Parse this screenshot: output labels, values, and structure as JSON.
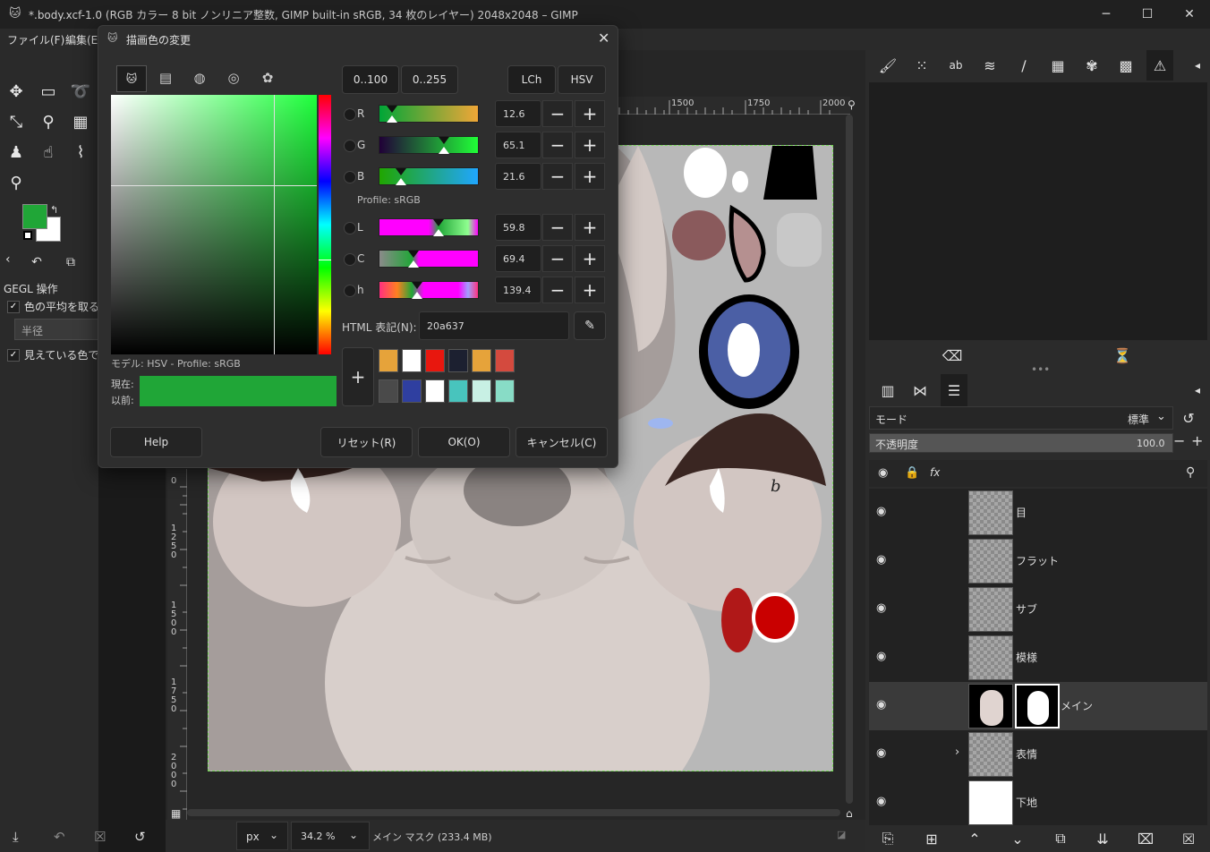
{
  "window": {
    "title": "*.body.xcf-1.0 (RGB カラー 8 bit ノンリニア整数, GIMP built-in sRGB, 34 枚のレイヤー) 2048x2048 – GIMP"
  },
  "menu": [
    "ファイル(F)",
    "編集(E)"
  ],
  "toolbox": {
    "gegl_label": "GEGL 操作",
    "avg_label": "色の平均を取る",
    "radius_label": "半径",
    "visible_label": "見えている色で"
  },
  "ruler": {
    "t1500": "1500",
    "t1750": "1750",
    "t2000": "2000"
  },
  "left_ruler": [
    "0",
    "1250",
    "1500",
    "1750",
    "2000"
  ],
  "statusbar": {
    "unit": "px",
    "zoom": "34.2 %",
    "info": "メイン マスク (233.4 MB)"
  },
  "dialog": {
    "title": "描画色の変更",
    "range_buttons": [
      "0..100",
      "0..255"
    ],
    "mode_buttons": [
      "LCh",
      "HSV"
    ],
    "channels": [
      {
        "label": "R",
        "value": "12.6"
      },
      {
        "label": "G",
        "value": "65.1"
      },
      {
        "label": "B",
        "value": "21.6"
      },
      {
        "label": "L",
        "value": "59.8"
      },
      {
        "label": "C",
        "value": "69.4"
      },
      {
        "label": "h",
        "value": "139.4"
      }
    ],
    "profile_label": "Profile: sRGB",
    "html_label": "HTML 表記(N):",
    "html_value": "20a637",
    "model_label": "モデル: HSV - Profile: sRGB",
    "current_label": "現在:",
    "previous_label": "以前:",
    "current_color": "#20a637",
    "swatches_row1": [
      "#e6a33a",
      "#ffffff",
      "#e8170e",
      "#1c2030",
      "#e6a33a",
      "#d44a3e"
    ],
    "swatches_row2": [
      "#4a4a4a",
      "#2f3fa0",
      "#ffffff",
      "#48c4bd",
      "#c8f0e4",
      "#88dcc6"
    ],
    "buttons": {
      "help": "Help",
      "reset": "リセット(R)",
      "ok": "OK(O)",
      "cancel": "キャンセル(C)"
    }
  },
  "layers_panel": {
    "mode_label": "モード",
    "mode_value": "標準",
    "opacity_label": "不透明度",
    "opacity_value": "100.0",
    "layers": [
      {
        "name": "目"
      },
      {
        "name": "フラット"
      },
      {
        "name": "サブ"
      },
      {
        "name": "模様"
      },
      {
        "name": "メイン"
      },
      {
        "name": "表情"
      },
      {
        "name": "下地"
      }
    ]
  },
  "canvas": {
    "scribble": "b"
  }
}
